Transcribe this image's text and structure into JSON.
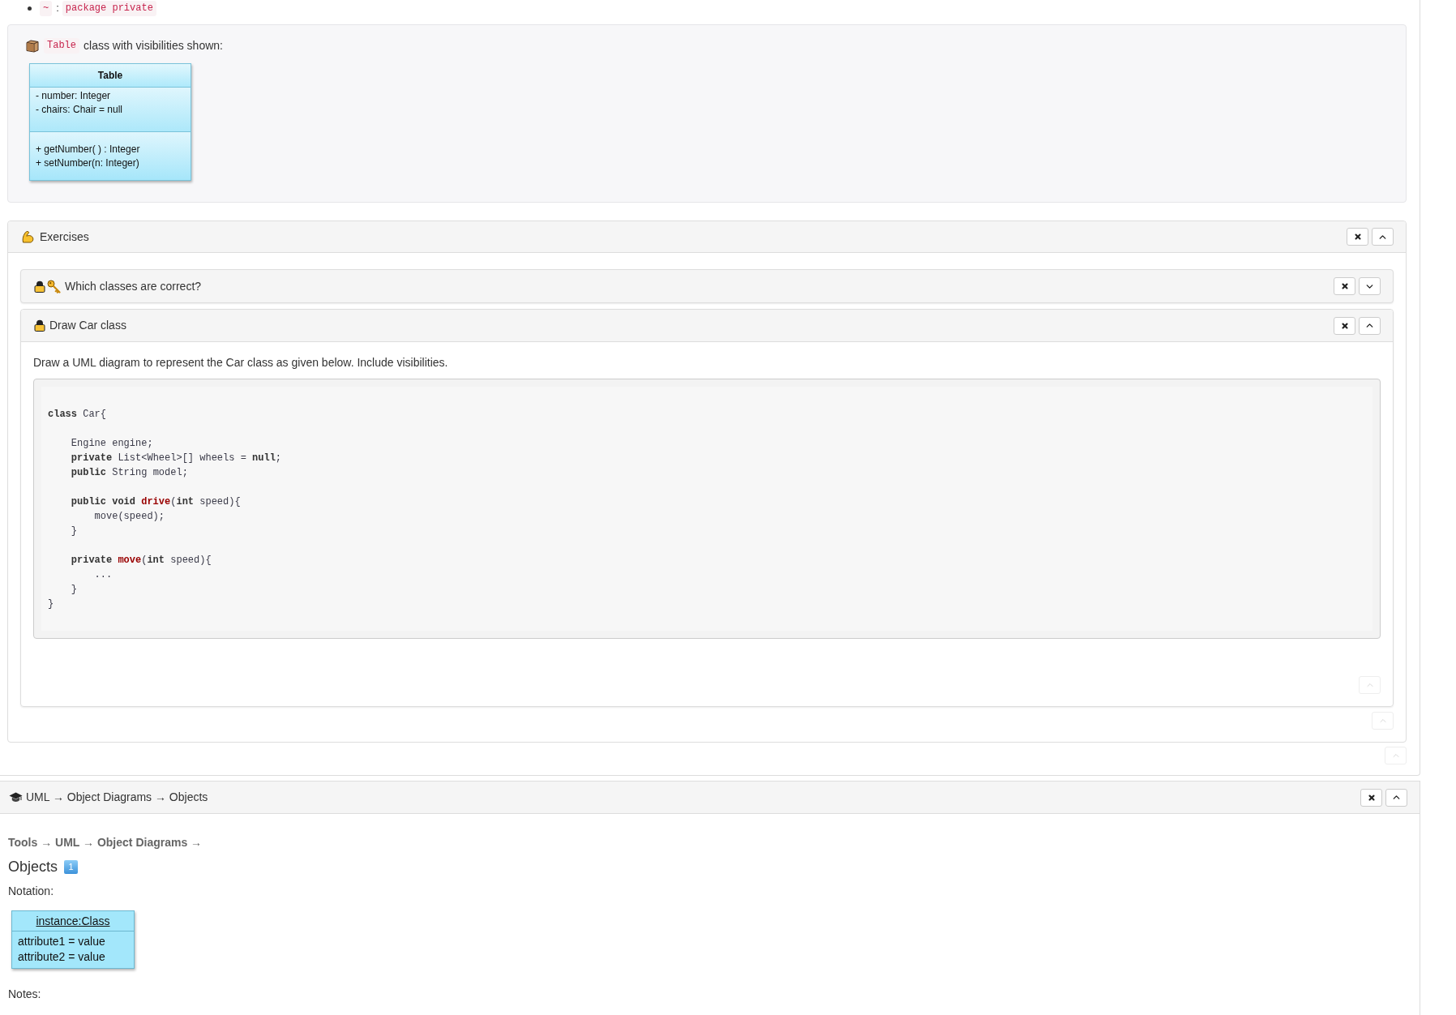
{
  "visibility_list": [
    {
      "symbol": "~",
      "separator": ":",
      "meaning": "package private"
    }
  ],
  "example_card": {
    "code": "Table",
    "text": "class with visibilities shown:",
    "uml_class": {
      "name": "Table",
      "attributes": [
        "- number: Integer",
        "- chairs: Chair = null"
      ],
      "methods": [
        "+ getNumber( ) : Integer",
        "+ setNumber(n: Integer)"
      ]
    }
  },
  "exercises": {
    "title": "Exercises",
    "expanded": true,
    "items": [
      {
        "title": "Which classes are correct?",
        "lock": true,
        "key": true,
        "expanded": false
      },
      {
        "title": "Draw Car class",
        "lock": true,
        "key": false,
        "expanded": true,
        "prompt": "Draw a UML diagram to represent the Car class as given below. Include visibilities.",
        "code_lines": [
          {
            "tokens": [
              {
                "text": "class",
                "kind": "keyword"
              },
              {
                "text": " Car{",
                "kind": "plain"
              }
            ],
            "children": [
              {
                "blank_line_before": true,
                "tokens": [
                  {
                    "text": "Engine engine;",
                    "kind": "plain"
                  }
                ]
              },
              {
                "tokens": [
                  {
                    "text": "private",
                    "kind": "keyword"
                  },
                  {
                    "text": " List<Wheel>[] wheels = ",
                    "kind": "plain"
                  },
                  {
                    "text": "null",
                    "kind": "keyword"
                  },
                  {
                    "text": ";",
                    "kind": "plain"
                  }
                ]
              },
              {
                "tokens": [
                  {
                    "text": "public",
                    "kind": "keyword"
                  },
                  {
                    "text": " String model;",
                    "kind": "plain"
                  }
                ]
              },
              {
                "blank_line_before": true,
                "tokens": [
                  {
                    "text": "public void ",
                    "kind": "keyword"
                  },
                  {
                    "text": "drive",
                    "kind": "title"
                  },
                  {
                    "text": "(",
                    "kind": "plain"
                  },
                  {
                    "text": "int",
                    "kind": "keyword"
                  },
                  {
                    "text": " speed){",
                    "kind": "plain"
                  }
                ],
                "children": [
                  {
                    "tokens": [
                      {
                        "text": "move(speed);",
                        "kind": "plain"
                      }
                    ]
                  }
                ]
              },
              {
                "tokens": [
                  {
                    "text": "}",
                    "kind": "plain"
                  }
                ]
              },
              {
                "blank_line_before": true,
                "tokens": [
                  {
                    "text": "private ",
                    "kind": "keyword"
                  },
                  {
                    "text": "move",
                    "kind": "title"
                  },
                  {
                    "text": "(",
                    "kind": "plain"
                  },
                  {
                    "text": "int",
                    "kind": "keyword"
                  },
                  {
                    "text": " speed){",
                    "kind": "plain"
                  }
                ],
                "children": [
                  {
                    "tokens": [
                      {
                        "text": "...",
                        "kind": "plain"
                      }
                    ]
                  }
                ]
              },
              {
                "tokens": [
                  {
                    "text": "}",
                    "kind": "plain"
                  }
                ]
              }
            ]
          },
          {
            "tokens": [
              {
                "text": "}",
                "kind": "plain"
              }
            ]
          }
        ]
      }
    ]
  },
  "objects_section": {
    "header": "UML → Object Diagrams → Objects",
    "expanded": true,
    "breadcrumb": "Tools → UML → Object Diagrams →",
    "title": "Objects",
    "title_badge": "1",
    "notation_label": "Notation:",
    "uml_object": {
      "name": "instance:Class",
      "attributes": [
        "attribute1 = value",
        "attribute2 = value"
      ]
    },
    "notes_label": "Notes:"
  }
}
